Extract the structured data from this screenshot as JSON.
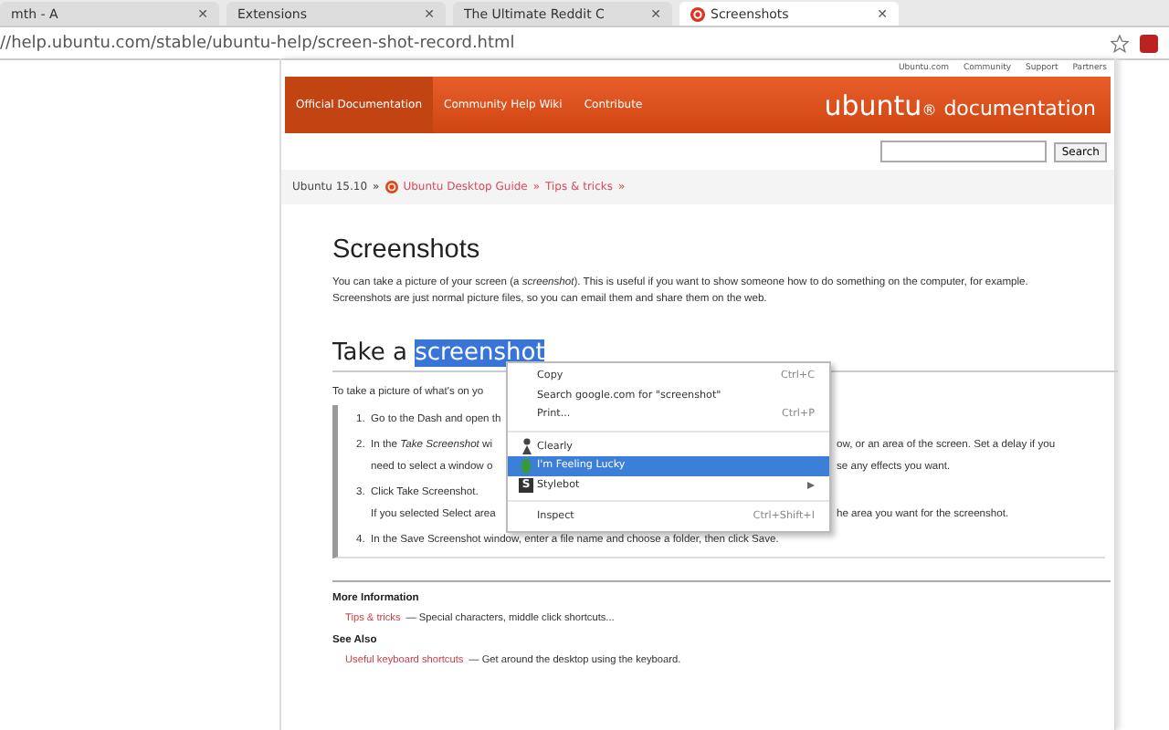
{
  "browser": {
    "tabs": [
      {
        "label": "mth - A",
        "close": "✕",
        "selected": false
      },
      {
        "label": "Extensions",
        "close": "✕",
        "selected": false
      },
      {
        "label": "The Ultimate Reddit C",
        "close": "✕",
        "selected": false
      },
      {
        "label": "Screenshots",
        "close": "✕",
        "selected": true
      }
    ],
    "address": "//help.ubuntu.com/stable/ubuntu-help/screen-shot-record.html"
  },
  "top_links": [
    "Ubuntu.com",
    "Community",
    "Support",
    "Partners"
  ],
  "header": {
    "nav": [
      {
        "label": "Official Documentation",
        "selected": true
      },
      {
        "label": "Community Help Wiki",
        "selected": false
      },
      {
        "label": "Contribute",
        "selected": false
      }
    ],
    "logo": "ubuntu",
    "logo_mark": "®",
    "logo_suffix": "documentation"
  },
  "search": {
    "button": "Search"
  },
  "breadcrumb": {
    "root": "Ubuntu 15.10",
    "sep1": "»",
    "guide": "Ubuntu Desktop Guide",
    "sep2": "»",
    "section": "Tips & tricks",
    "sep3": "»"
  },
  "title": "Screenshots",
  "intro": "You can take a picture of your screen (a *screenshot*). This is useful if you want to show someone how to do something on the computer, for example. Screenshots are just normal picture files, so you can email them and share them on the web.",
  "heading": {
    "text": "Take a ",
    "selection": "screenshot"
  },
  "lead": "To take a picture of what's on yo",
  "steps": [
    {
      "number": "1.",
      "lines": [
        {
          "left": "Go to the Dash and open th"
        }
      ]
    },
    {
      "number": "2.",
      "lines": [
        {
          "left": "In the *Take Screenshot* wi",
          "right": "ow, or an area of the screen. Set a delay if you"
        },
        {
          "left": "need to select a window o",
          "right": "se any effects you want."
        }
      ]
    },
    {
      "number": "3.",
      "lines": [
        {
          "left": "Click Take Screenshot."
        },
        {
          "left": "If you selected Select area",
          "right": "he area you want for the screenshot."
        }
      ]
    },
    {
      "number": "4.",
      "lines": [
        {
          "left": "In the Save Screenshot window, enter a file name and choose a folder, then click Save."
        }
      ]
    }
  ],
  "context_menu": [
    {
      "kind": "item",
      "label": "Copy",
      "shortcut": "Ctrl+C",
      "selected": false
    },
    {
      "kind": "item",
      "label": "Search google.com for \"screenshot\"",
      "selected": false
    },
    {
      "kind": "item",
      "label": "Print...",
      "shortcut": "Ctrl+P",
      "selected": false
    },
    {
      "kind": "separator"
    },
    {
      "kind": "figure",
      "label": "Clearly",
      "selected": false
    },
    {
      "kind": "leaf",
      "label": "I'm Feeling Lucky",
      "selected": true
    },
    {
      "kind": "submenu",
      "icon_text": "S",
      "label": "Stylebot",
      "selected": false
    },
    {
      "kind": "separator"
    },
    {
      "kind": "item",
      "label": "Inspect",
      "shortcut": "Ctrl+Shift+I",
      "selected": false
    }
  ],
  "more_information": {
    "heading": "More Information",
    "link": "Tips & tricks",
    "text": "— Special characters, middle click shortcuts..."
  },
  "see_also": {
    "heading": "See Also",
    "link": "Useful keyboard shortcuts",
    "text": "— Get around the desktop using the keyboard."
  }
}
